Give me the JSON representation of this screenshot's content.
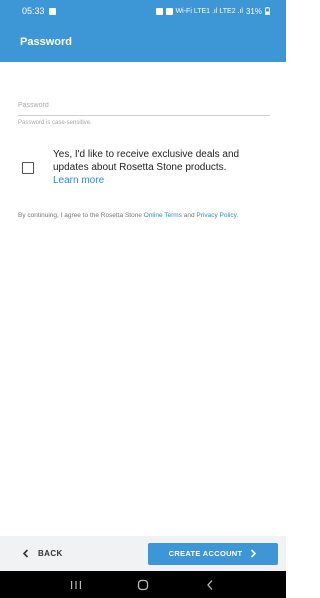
{
  "status_bar": {
    "time": "05:33",
    "signal_text": "Wi-Fi LTE1 .ıl LTE2 .ıl",
    "battery_percent": "31%"
  },
  "app_bar": {
    "title": "Password"
  },
  "password_field": {
    "placeholder": "Password",
    "value": "",
    "helper_text": "Password is case-sensitive."
  },
  "opt_in": {
    "checked": false,
    "label": "Yes, I'd like to receive exclusive deals and updates about Rosetta Stone products.",
    "learn_more": "Learn more"
  },
  "terms": {
    "prefix": "By continuing, I agree to the Rosetta Stone",
    "online_terms": "Online Terms",
    "and": "and",
    "privacy_policy": "Privacy Policy",
    "suffix": "."
  },
  "footer": {
    "back_label": "BACK",
    "create_label": "CREATE ACCOUNT"
  },
  "colors": {
    "primary": "#3d96d6",
    "link": "#2f8bd0"
  }
}
